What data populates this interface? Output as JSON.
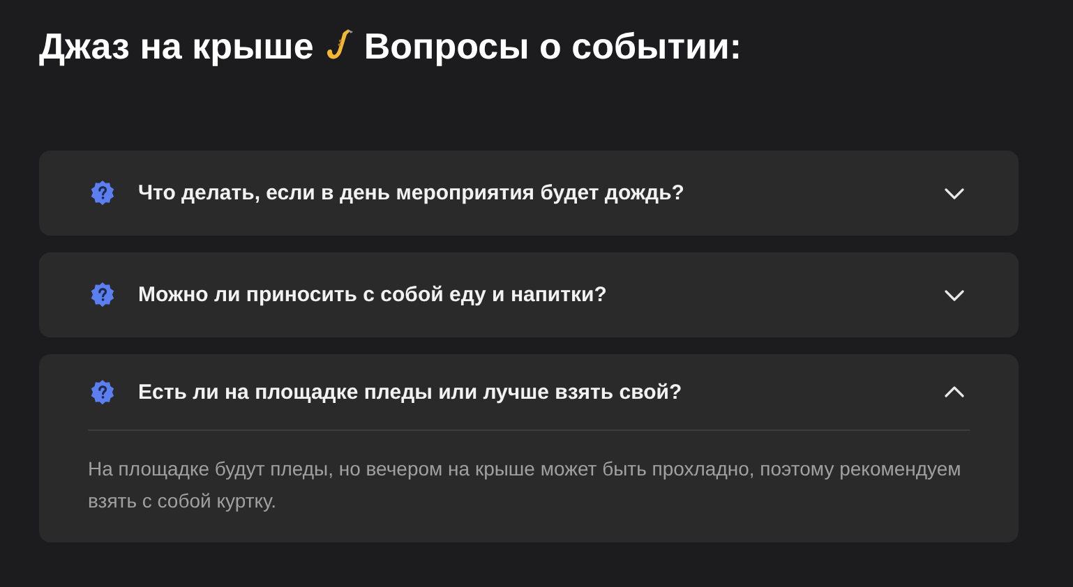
{
  "title": {
    "lead": "Джаз на крыше",
    "rest": "Вопросы о событии:"
  },
  "faq": [
    {
      "question": "Что делать, если в день мероприятия будет дождь?",
      "expanded": false
    },
    {
      "question": "Можно ли приносить с собой еду и напитки?",
      "expanded": false
    },
    {
      "question": "Есть ли на площадке пледы или лучше взять свой?",
      "expanded": true,
      "answer": "На площадке будут пледы, но вечером на крыше может быть прохладно, поэтому рекомендуем взять с собой куртку."
    }
  ]
}
